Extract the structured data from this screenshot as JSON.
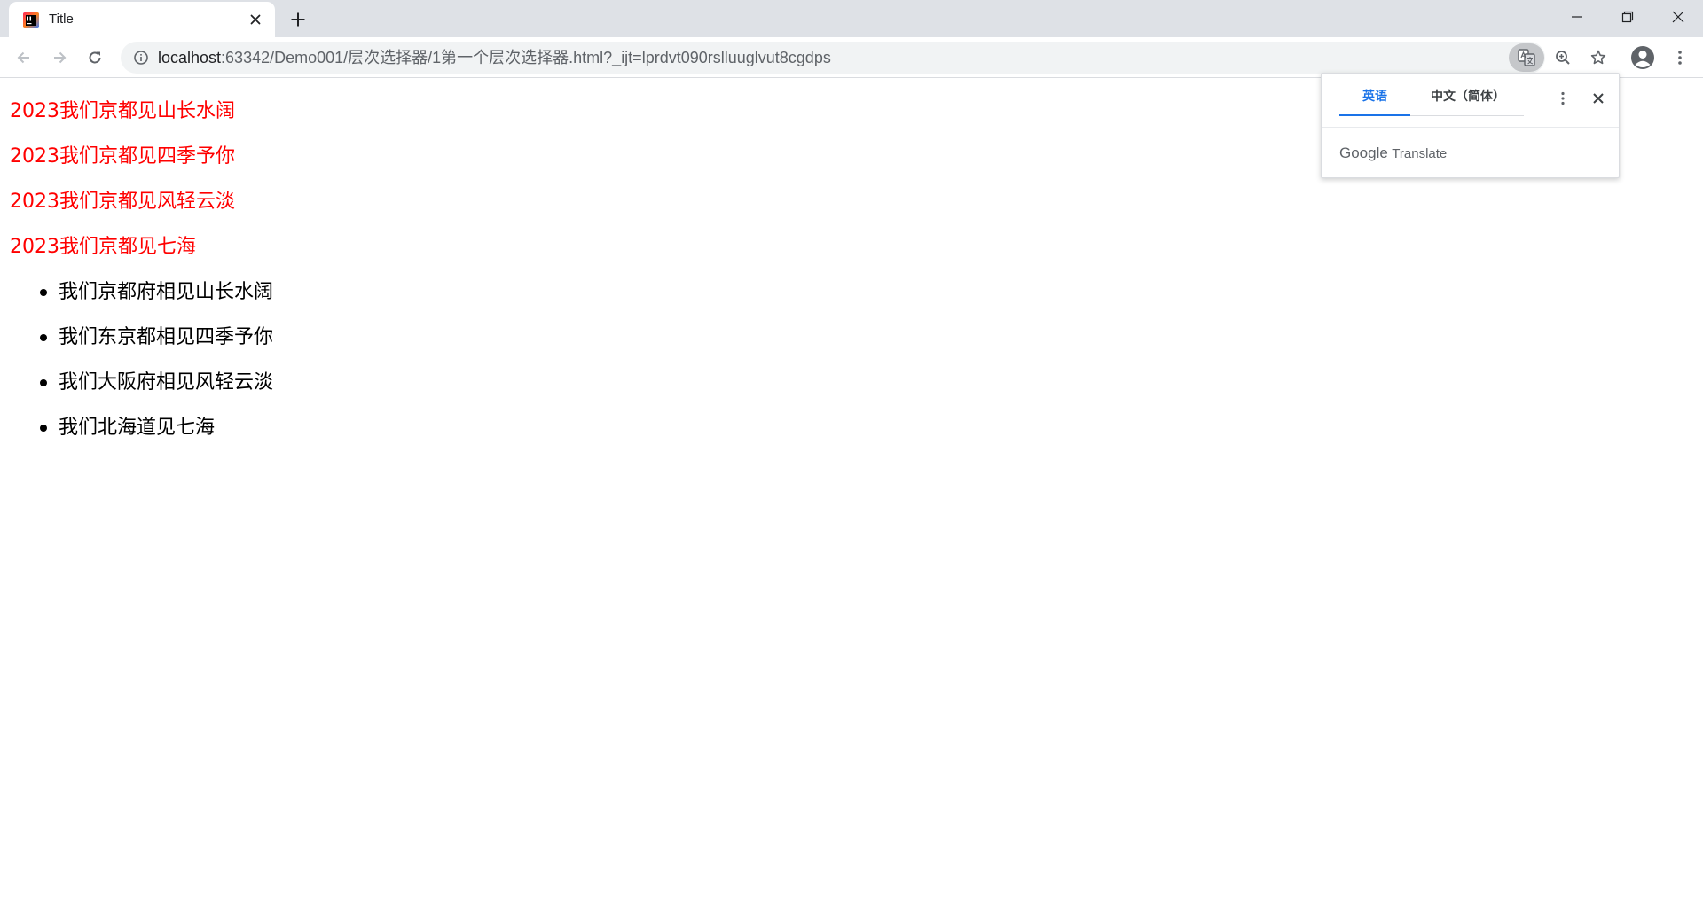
{
  "browser": {
    "tab": {
      "title": "Title",
      "favicon": "intellij-icon"
    },
    "new_tab_icon": "plus-icon",
    "window_controls": [
      "minimize-icon",
      "restore-icon",
      "close-icon"
    ],
    "url": {
      "host": "localhost",
      "path": ":63342/Demo001/层次选择器/1第一个层次选择器.html?_ijt=lprdvt090rslluuglvut8cgdps"
    }
  },
  "page": {
    "red_lines": [
      "2023我们京都见山长水阔",
      "2023我们京都见四季予你",
      "2023我们京都见风轻云淡",
      "2023我们京都见七海"
    ],
    "list_items": [
      "我们京都府相见山长水阔",
      "我们东京都相见四季予你",
      "我们大阪府相见风轻云淡",
      "我们北海道见七海"
    ]
  },
  "translate_bubble": {
    "source_lang": "英语",
    "target_lang": "中文（简体）",
    "brand_google": "Google",
    "brand_translate": "Translate"
  },
  "colors": {
    "red_text": "#ff0000",
    "active_tab": "#1a73e8",
    "tabstrip": "#dee1e6"
  }
}
